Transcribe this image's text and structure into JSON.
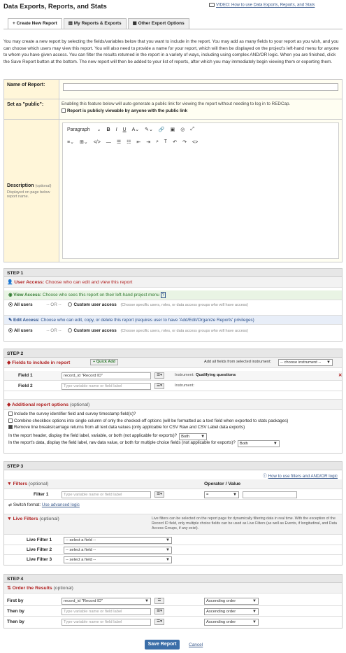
{
  "header": {
    "title": "Data Exports, Reports, and Stats",
    "video_link": "VIDEO: How to use Data Exports, Reports, and Stats"
  },
  "tabs": [
    {
      "label": "Create New Report"
    },
    {
      "label": "My Reports & Exports"
    },
    {
      "label": "Other Export Options"
    }
  ],
  "intro": "You may create a new report by selecting the fields/variables below that you want to include in the report. You may add as many fields to your report as you wish, and you can choose which users may view this report. You will also need to provide a name for your report, which will then be displayed on the project's left-hand menu for anyone to whom you have given access. You can filter the results returned in the report in a variety of ways, including using complex AND/OR logic. When you are finished, click the Save Report button at the bottom. The new report will then be added to your list of reports, after which you may immediately begin viewing them or exporting them.",
  "form": {
    "name_label": "Name of Report:",
    "public_label": "Set as \"public\":",
    "public_note": "Enabling this feature below will auto-generate a public link for viewing the report without needing to log in to REDCap.",
    "public_checkbox": "Report is publicly viewable by anyone with the public link",
    "description_label": "Description",
    "description_optional": "(optional)",
    "description_hint": "Displayed on page below report name.",
    "editor_format": "Paragraph"
  },
  "step1": {
    "title": "STEP 1",
    "user_access": "User Access:",
    "user_access_desc": "Choose who can edit and view this report",
    "view_access": "View Access:",
    "view_access_desc": "Choose who sees this report on their left-hand project menu",
    "view_help": "?",
    "edit_access": "Edit Access:",
    "edit_access_desc": "Choose who can edit, copy, or delete this report (requires user to have 'Add/Edit/Organize Reports' privileges)",
    "all_users": "All users",
    "or": "-- OR --",
    "custom_access": "Custom user access",
    "custom_hint": "(Choose specific users, roles, or data access groups who will have access)"
  },
  "step2": {
    "title": "STEP 2",
    "fields_title": "Fields to include in report",
    "quick_add": "+ Quick Add",
    "add_all_label": "Add all fields from selected instrument:",
    "choose_instrument": "-- choose instrument --",
    "field1_label": "Field 1",
    "field1_value": "record_id \"Record ID\"",
    "field1_instrument_label": "Instrument:",
    "field1_instrument": "Qualifying questions",
    "field2_label": "Field 2",
    "field2_placeholder": "Type variable name or field label",
    "field2_instrument_label": "Instrument:",
    "addl_title": "Additional report options",
    "addl_optional": "(optional)",
    "opt1": "Include the survey identifier field and survey timestamp field(s)?",
    "opt2": "Combine checkbox options into single column of only the checked-off options (will be formatted as a text field when exported to stats packages)",
    "opt3": "Remove line breaks/carriage returns from all text data values (only applicable for CSV Raw and CSV Label data exports)",
    "opt4": "In the report header, display the field label, variable, or both (not applicable for exports)?",
    "opt4_value": "Both",
    "opt5": "In the report's data, display the field label, raw data value, or both for multiple choice fields (not applicable for exports)?",
    "opt5_value": "Both"
  },
  "step3": {
    "title": "STEP 3",
    "help_link": "How to use filters and AND/OR logic",
    "filters_title": "Filters",
    "filters_optional": "(optional)",
    "operator_value": "Operator / Value",
    "filter1_label": "Filter 1",
    "filter1_placeholder": "Type variable name or field label",
    "operator_default": "=",
    "switch_format": "Switch format:",
    "advanced_logic": "Use advanced logic",
    "live_title": "Live Filters",
    "live_optional": "(optional)",
    "live_desc": "Live filters can be selected on the report page for dynamically filtering data in real time. With the exception of the Record ID field, only multiple choice fields can be used as Live Filters (as well as Events, if longitudinal, and Data Access Groups, if any exist).",
    "live1_label": "Live Filter 1",
    "live2_label": "Live Filter 2",
    "live3_label": "Live Filter 3",
    "select_field": "-- select a field --"
  },
  "step4": {
    "title": "STEP 4",
    "order_title": "Order the Results",
    "order_optional": "(optional)",
    "first_by": "First by",
    "then_by1": "Then by",
    "then_by2": "Then by",
    "first_value": "record_id \"Record ID\"",
    "placeholder": "Type variable name or field label",
    "ascending": "Ascending order"
  },
  "buttons": {
    "save": "Save Report",
    "cancel": "Cancel"
  }
}
